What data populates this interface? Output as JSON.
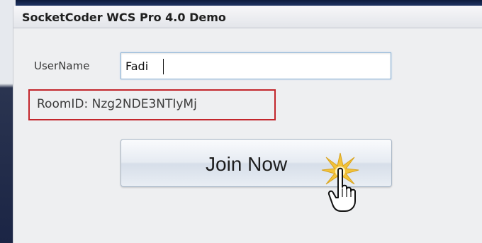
{
  "window": {
    "title": "SocketCoder WCS Pro 4.0 Demo"
  },
  "form": {
    "username_label": "UserName",
    "username_value": "Fadi",
    "roomid_text": "RoomID: Nzg2NDE3NTIyMj",
    "join_label": "Join Now"
  },
  "icons": {
    "cursor": "hand-pointer-icon",
    "click_effect": "click-burst-icon"
  },
  "colors": {
    "highlight_border": "#c3262c",
    "input_focus_border": "#8fb4d6",
    "burst": "#f2c33a"
  }
}
